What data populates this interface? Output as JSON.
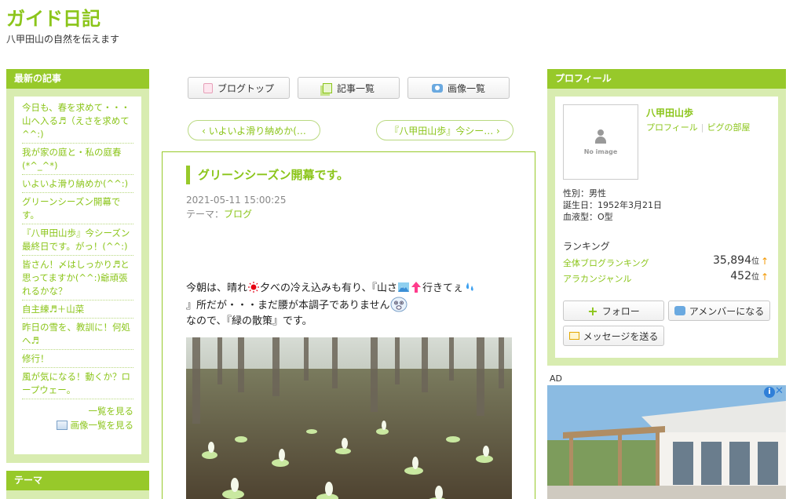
{
  "blog": {
    "title": "ガイド日記",
    "description": "八甲田山の自然を伝えます"
  },
  "recent": {
    "heading": "最新の記事",
    "items": [
      "今日も、春を求めて・・・山へ入る♬（えさを求めて^^:)",
      "我が家の庭と・私の庭春(*^_^*)",
      "いよいよ滑り納めか(^^:)",
      "グリーンシーズン開幕です。",
      "『八甲田山歩』今シーズン最終日です。がっ！(^^:)",
      "皆さん！〆はしっかり♬と思ってますか(^^:)爺頑張れるかな？",
      "自主練♬＋山菜",
      "昨日の雪を、教訓に！何処へ♬",
      "修行！",
      "風が気になる！動くか？ロープウェー。"
    ],
    "see_all": "一覧を見る",
    "see_images": "画像一覧を見る"
  },
  "theme_box": {
    "heading": "テーマ"
  },
  "nav": {
    "blog_top": "ブログトップ",
    "article_list": "記事一覧",
    "image_list": "画像一覧"
  },
  "pager": {
    "prev": "‹ いよいよ滑り納めか(…",
    "next": "『八甲田山歩』今シー… ›"
  },
  "article": {
    "title": "グリーンシーズン開幕です。",
    "date": "2021-05-11 15:00:25",
    "theme_label": "テーマ：",
    "theme_value": "ブログ",
    "line1a": "今朝は、晴れ",
    "line1b": "夕べの冷え込みも有り、『山さ",
    "line1c": "行きてぇ",
    "line2": "』所だが・・・まだ腰が本調子でありません",
    "line3": "なので、『緑の散策』です。"
  },
  "profile": {
    "heading": "プロフィール",
    "no_image": "No image",
    "name": "八甲田山歩",
    "link_profile": "プロフィール",
    "link_room": "ピグの部屋",
    "gender": "性別：男性",
    "birthday": "誕生日：1952年3月21日",
    "blood": "血液型：O型",
    "ranking_heading": "ランキング",
    "rank1_label": "全体ブログランキング",
    "rank1_value": "35,894",
    "rank2_label": "アラカンジャンル",
    "rank2_value": "452",
    "rank_unit": "位",
    "rank_arrow": "↑",
    "follow": "フォロー",
    "member": "アメンバーになる",
    "message": "メッセージを送る"
  },
  "ad": {
    "label": "AD",
    "choice": "i",
    "close": "✕"
  }
}
